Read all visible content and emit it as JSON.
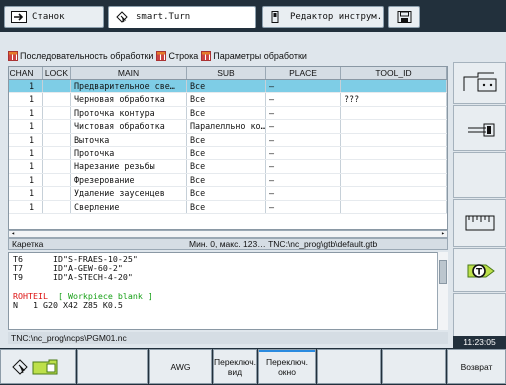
{
  "tabs": [
    {
      "label": "Станок",
      "icon": "machine-icon"
    },
    {
      "label": "smart.Turn",
      "icon": "diamond-pointer-icon"
    },
    {
      "label": "Редактор инструм.",
      "icon": "tool-editor-icon"
    },
    {
      "label": "",
      "icon": "save-disk-icon"
    }
  ],
  "toolbar": {
    "seq_label": "Последовательность обработки",
    "row_label": "Строка",
    "params_label": "Параметры обработки"
  },
  "table": {
    "headers": [
      "CHAN",
      "LOCK",
      "MAIN",
      "SUB",
      "PLACE",
      "TOOL_ID"
    ],
    "rows": [
      {
        "chan": "1",
        "lock": "",
        "main": "Предварительное све…",
        "sub": "Все",
        "place": "–",
        "tool": ""
      },
      {
        "chan": "1",
        "lock": "",
        "main": "Черновая обработка",
        "sub": "Все",
        "place": "–",
        "tool": "???"
      },
      {
        "chan": "1",
        "lock": "",
        "main": "Проточка контура",
        "sub": "Все",
        "place": "–",
        "tool": ""
      },
      {
        "chan": "1",
        "lock": "",
        "main": "Чистовая обработка",
        "sub": "Паралелльно ко…",
        "place": "–",
        "tool": ""
      },
      {
        "chan": "1",
        "lock": "",
        "main": "Выточка",
        "sub": "Все",
        "place": "–",
        "tool": ""
      },
      {
        "chan": "1",
        "lock": "",
        "main": "Проточка",
        "sub": "Все",
        "place": "–",
        "tool": ""
      },
      {
        "chan": "1",
        "lock": "",
        "main": "Нарезание резьбы",
        "sub": "Все",
        "place": "–",
        "tool": ""
      },
      {
        "chan": "1",
        "lock": "",
        "main": "Фрезерование",
        "sub": "Все",
        "place": "–",
        "tool": ""
      },
      {
        "chan": "1",
        "lock": "",
        "main": "Удаление заусенцев",
        "sub": "Все",
        "place": "–",
        "tool": ""
      },
      {
        "chan": "1",
        "lock": "",
        "main": "Сверление",
        "sub": "Все",
        "place": "–",
        "tool": ""
      }
    ]
  },
  "info": {
    "left": "Каретка",
    "right": "Мин. 0, макс. 123… TNC:\\nc_prog\\gtb\\default.gtb"
  },
  "program": {
    "l1": "T6      ID\"S-FRAES-10-25\"",
    "l2": "T7      ID\"A-GEW-60-2\"",
    "l3": "T9      ID\"A-STECH-4-20\"",
    "l4_red": "ROHTEIL",
    "l4_green": "  [ Workpiece blank ]",
    "l5": "N   1 G20 X42 Z85 K0.5"
  },
  "path": "TNC:\\nc_prog\\ncps\\PGM01.nc",
  "clock": "11:23:05",
  "bottom": {
    "awg": "AWG",
    "view": "Переключ. вид",
    "window": "Переключ. окно",
    "back": "Возврат"
  }
}
